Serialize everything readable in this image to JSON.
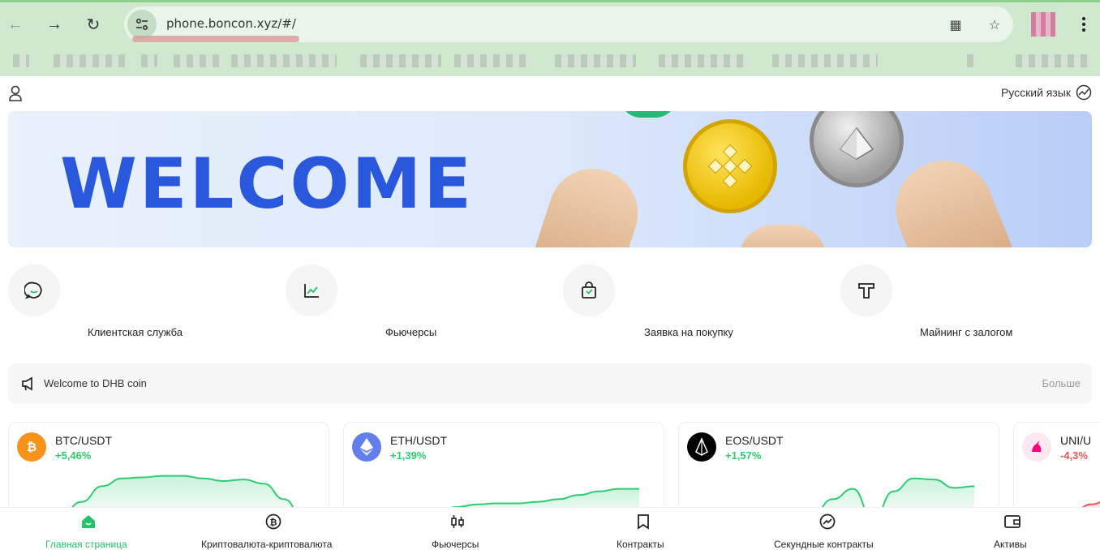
{
  "browser": {
    "url": "phone.boncon.xyz/#/"
  },
  "header": {
    "language_label": "Русский язык"
  },
  "banner": {
    "title": "WELCOME"
  },
  "quick_actions": [
    {
      "label": "Клиентская служба",
      "icon": "chat-icon"
    },
    {
      "label": "Фьючерсы",
      "icon": "chart-icon"
    },
    {
      "label": "Заявка на покупку",
      "icon": "shopping-bag-icon"
    },
    {
      "label": "Майнинг с залогом",
      "icon": "t-icon"
    }
  ],
  "notice": {
    "text": "Welcome to DHB coin",
    "more_label": "Больше"
  },
  "market_cards": [
    {
      "pair": "BTC/USDT",
      "change": "+5,46%",
      "direction": "up",
      "coin_color": "#f7931a",
      "points": [
        0.95,
        0.9,
        0.65,
        0.35,
        0.2,
        0.18,
        0.15,
        0.15,
        0.2,
        0.25,
        0.22,
        0.3,
        0.6,
        1.0
      ]
    },
    {
      "pair": "ETH/USDT",
      "change": "+1,39%",
      "direction": "up",
      "coin_color": "#627eea",
      "points": [
        1.0,
        0.95,
        0.9,
        0.82,
        0.75,
        0.7,
        0.68,
        0.68,
        0.65,
        0.6,
        0.52,
        0.45,
        0.4,
        0.4
      ]
    },
    {
      "pair": "EOS/USDT",
      "change": "+1,57%",
      "direction": "up",
      "coin_color": "#000000",
      "points": [
        1.0,
        0.9,
        0.85,
        0.88,
        0.95,
        0.9,
        0.6,
        0.4,
        1.0,
        0.45,
        0.2,
        0.22,
        0.38,
        0.35
      ]
    },
    {
      "pair": "UNI/U",
      "change": "-4,3%",
      "direction": "down",
      "coin_color": "#ff007a",
      "points": [
        1.0,
        0.85,
        0.7,
        0.6
      ]
    }
  ],
  "colors": {
    "up": "#2ecc71",
    "down": "#f05656",
    "accent": "#24c26b"
  },
  "tabbar": [
    {
      "label": "Главная страница",
      "icon": "home-icon",
      "active": true
    },
    {
      "label": "Криптовалюта-криптовалюта",
      "icon": "bitcoin-icon",
      "active": false
    },
    {
      "label": "Фьючерсы",
      "icon": "candles-icon",
      "active": false
    },
    {
      "label": "Контракты",
      "icon": "bookmark-icon",
      "active": false
    },
    {
      "label": "Секундные контракты",
      "icon": "trend-circle-icon",
      "active": false
    },
    {
      "label": "Активы",
      "icon": "wallet-icon",
      "active": false
    }
  ]
}
